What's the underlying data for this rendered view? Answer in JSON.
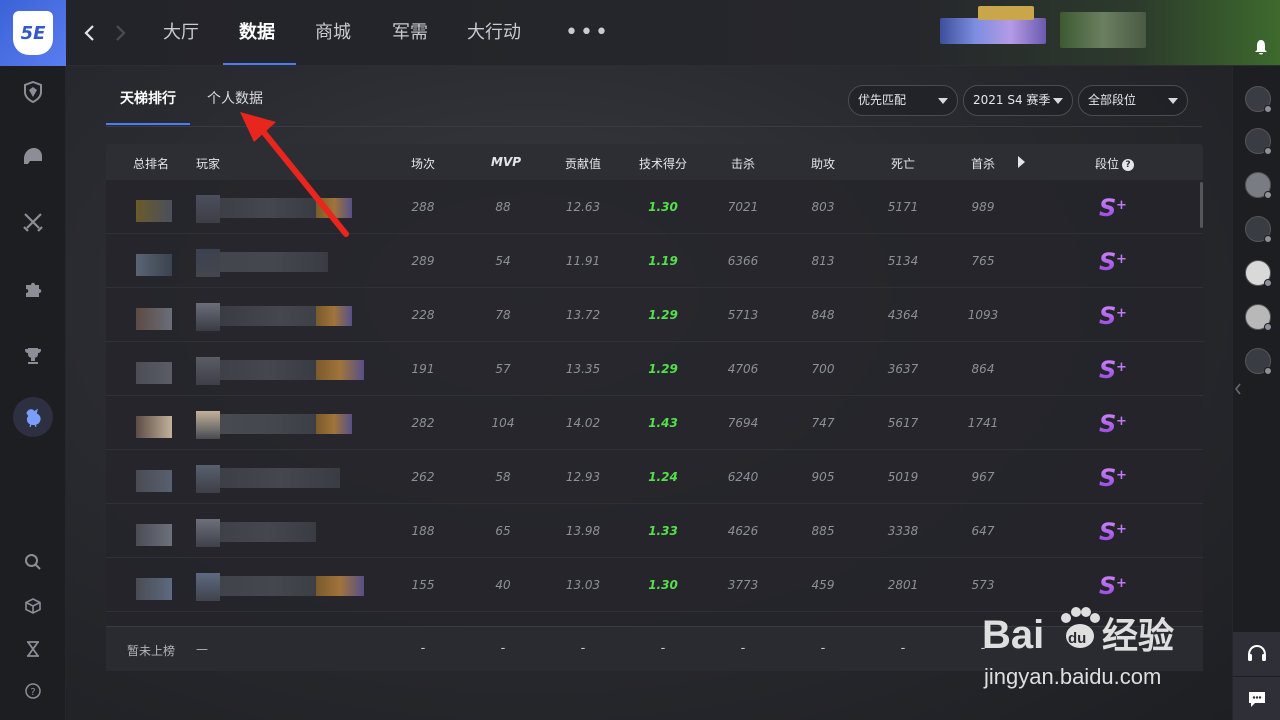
{
  "app": {
    "logo_text": "5E"
  },
  "top_nav": {
    "items": [
      {
        "id": "lobby",
        "label": "大厅"
      },
      {
        "id": "data",
        "label": "数据",
        "active": true
      },
      {
        "id": "shop",
        "label": "商城"
      },
      {
        "id": "supply",
        "label": "军需"
      },
      {
        "id": "operation",
        "label": "大行动"
      }
    ],
    "more": "•••"
  },
  "sub_tabs": [
    {
      "label": "天梯排行",
      "active": true
    },
    {
      "label": "个人数据"
    }
  ],
  "filters": {
    "mode": "优先匹配",
    "season": "2021 S4 赛季",
    "tier": "全部段位"
  },
  "table": {
    "headers": {
      "rank": "总排名",
      "player": "玩家",
      "matches": "场次",
      "mvp": "MVP",
      "contribution": "贡献值",
      "skill": "技术得分",
      "kills": "击杀",
      "assists": "助攻",
      "deaths": "死亡",
      "first_kills": "首杀",
      "tier": "段位"
    },
    "rows": [
      {
        "matches": "288",
        "mvp": "88",
        "contribution": "12.63",
        "skill": "1.30",
        "kills": "7021",
        "assists": "803",
        "deaths": "5171",
        "first_kills": "989",
        "tier": "S+"
      },
      {
        "matches": "289",
        "mvp": "54",
        "contribution": "11.91",
        "skill": "1.19",
        "kills": "6366",
        "assists": "813",
        "deaths": "5134",
        "first_kills": "765",
        "tier": "S+"
      },
      {
        "matches": "228",
        "mvp": "78",
        "contribution": "13.72",
        "skill": "1.29",
        "kills": "5713",
        "assists": "848",
        "deaths": "4364",
        "first_kills": "1093",
        "tier": "S+"
      },
      {
        "matches": "191",
        "mvp": "57",
        "contribution": "13.35",
        "skill": "1.29",
        "kills": "4706",
        "assists": "700",
        "deaths": "3637",
        "first_kills": "864",
        "tier": "S+"
      },
      {
        "matches": "282",
        "mvp": "104",
        "contribution": "14.02",
        "skill": "1.43",
        "kills": "7694",
        "assists": "747",
        "deaths": "5617",
        "first_kills": "1741",
        "tier": "S+"
      },
      {
        "matches": "262",
        "mvp": "58",
        "contribution": "12.93",
        "skill": "1.24",
        "kills": "6240",
        "assists": "905",
        "deaths": "5019",
        "first_kills": "967",
        "tier": "S+"
      },
      {
        "matches": "188",
        "mvp": "65",
        "contribution": "13.98",
        "skill": "1.33",
        "kills": "4626",
        "assists": "885",
        "deaths": "3338",
        "first_kills": "647",
        "tier": "S+"
      },
      {
        "matches": "155",
        "mvp": "40",
        "contribution": "13.03",
        "skill": "1.30",
        "kills": "3773",
        "assists": "459",
        "deaths": "2801",
        "first_kills": "573",
        "tier": "S+"
      }
    ],
    "footer": {
      "label": "暂未上榜",
      "player": "—",
      "dash": "-"
    }
  },
  "watermark": {
    "line1": "Bai",
    "line1b": "du",
    "line1c": "经验",
    "line2": "jingyan.baidu.com"
  },
  "colors": {
    "accent": "#4b7cf5",
    "skill_green": "#55e04b",
    "tier_purple": "#b85cf0",
    "annotation_red": "#e8261e"
  }
}
